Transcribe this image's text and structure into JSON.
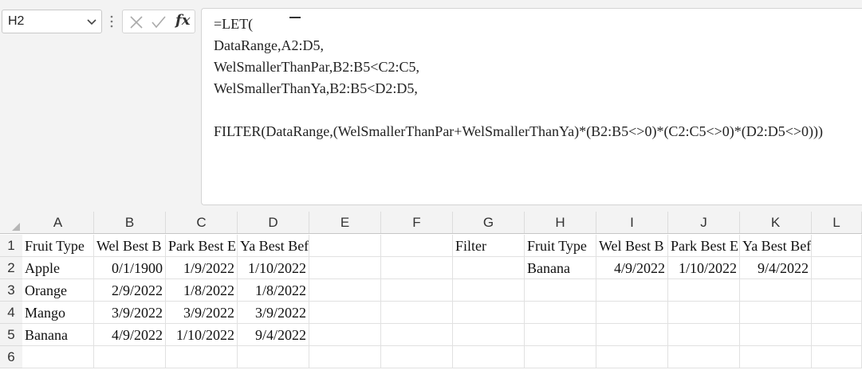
{
  "name_box": {
    "value": "H2"
  },
  "formula": {
    "lines": [
      "=LET(",
      "DataRange,A2:D5,",
      "WelSmallerThanPar,B2:B5<C2:C5,",
      "WelSmallerThanYa,B2:B5<D2:D5,",
      "",
      "FILTER(DataRange,(WelSmallerThanPar+WelSmallerThanYa)*(B2:B5<>0)*(C2:C5<>0)*(D2:D5<>0)))"
    ]
  },
  "icons": {
    "name_box_dropdown": "chevron-down-icon",
    "options": "vertical-dots-icon",
    "cancel": "x-icon",
    "enter": "check-icon",
    "function": "fx-icon"
  },
  "fx_label": "fx",
  "columns": [
    "A",
    "B",
    "C",
    "D",
    "E",
    "F",
    "G",
    "H",
    "I",
    "J",
    "K",
    "L"
  ],
  "rows": [
    "1",
    "2",
    "3",
    "4",
    "5",
    "6"
  ],
  "cells": {
    "A1": "Fruit Type",
    "B1": "Wel Best B",
    "C1": "Park Best E",
    "D1": "Ya Best Befre",
    "A2": "Apple",
    "B2": "0/1/1900",
    "C2": "1/9/2022",
    "D2": "1/10/2022",
    "A3": "Orange",
    "B3": "2/9/2022",
    "C3": "1/8/2022",
    "D3": "1/8/2022",
    "A4": "Mango",
    "B4": "3/9/2022",
    "C4": "3/9/2022",
    "D4": "3/9/2022",
    "A5": "Banana",
    "B5": "4/9/2022",
    "C5": "1/10/2022",
    "D5": "9/4/2022",
    "G1": "Filter",
    "H1": "Fruit Type",
    "I1": "Wel Best B",
    "J1": "Park Best E",
    "K1": "Ya Best Befre",
    "H2": "Banana",
    "I2": "4/9/2022",
    "J2": "1/10/2022",
    "K2": "9/4/2022"
  }
}
